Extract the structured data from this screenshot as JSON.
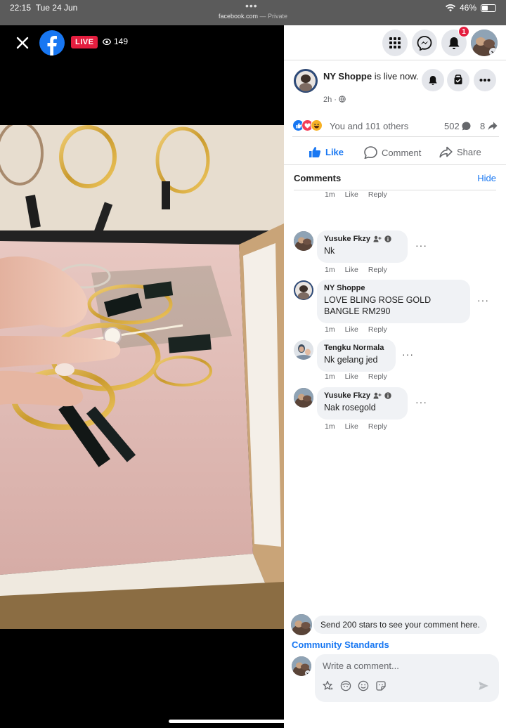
{
  "status_bar": {
    "time": "22:15",
    "date": "Tue 24 Jun",
    "url": "facebook.com",
    "url_suffix": "— Private",
    "battery": "46%",
    "battery_level": 0.46
  },
  "video": {
    "live_label": "LIVE",
    "viewer_count": "149",
    "icons": {
      "close": "close-icon",
      "brand": "facebook-logo",
      "viewers": "eye-icon"
    }
  },
  "header": {
    "notification_count": "1",
    "icons": [
      "grid-menu-icon",
      "messenger-icon",
      "bell-icon"
    ]
  },
  "post": {
    "author": "NY Shoppe",
    "status_text": "is live now.",
    "time": "2h",
    "privacy_icon": "globe-icon",
    "reactions_text": "You and 101 others",
    "comment_count": "502",
    "share_count": "8",
    "reaction_icons": [
      "like",
      "love",
      "haha"
    ]
  },
  "actions": {
    "like": "Like",
    "comment": "Comment",
    "share": "Share"
  },
  "comments_section": {
    "title": "Comments",
    "hide": "Hide",
    "partial_meta": {
      "time": "1m",
      "like": "Like",
      "reply": "Reply"
    },
    "items": [
      {
        "name": "Yusuke Fkzy",
        "text": "Nk",
        "time": "1m",
        "like": "Like",
        "reply": "Reply",
        "badges": true
      },
      {
        "name": "NY Shoppe",
        "text": "LOVE BLING ROSE GOLD BANGLE RM290",
        "time": "1m",
        "like": "Like",
        "reply": "Reply",
        "badges": false
      },
      {
        "name": "Tengku Normala",
        "text": "Nk gelang jed",
        "time": "1m",
        "like": "Like",
        "reply": "Reply",
        "badges": false
      },
      {
        "name": "Yusuke Fkzy",
        "text": "Nak rosegold",
        "time": "1m",
        "like": "Like",
        "reply": "Reply",
        "badges": true
      }
    ]
  },
  "footer": {
    "stars_prompt": "Send 200 stars to see your comment here.",
    "community_standards": "Community Standards",
    "write_placeholder": "Write a comment...",
    "composer_icons": [
      "stars-icon",
      "avatar-sticker-icon",
      "emoji-icon",
      "sticker-icon",
      "send-icon"
    ]
  },
  "colors": {
    "accent": "#1877f2",
    "live_red": "#e41e3f",
    "bubble": "#f0f2f5",
    "muted": "#65676b"
  }
}
